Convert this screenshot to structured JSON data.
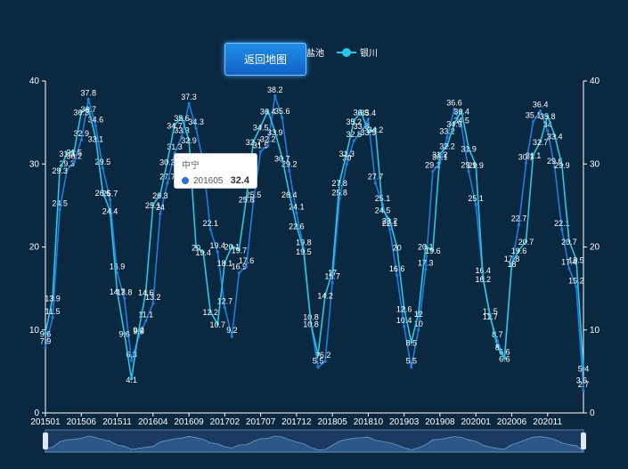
{
  "back_button": "返回地图",
  "legend": [
    {
      "name": "盐池",
      "color": "#1e7ee0"
    },
    {
      "name": "银川",
      "color": "#29c6e8"
    }
  ],
  "tooltip": {
    "title": "中宁",
    "category": "201605",
    "value": "32.4",
    "color": "#2f6fd8"
  },
  "chart_data": {
    "type": "line",
    "ylim": [
      0,
      40
    ],
    "y_ticks": [
      "0",
      "10",
      "20",
      "30",
      "40"
    ],
    "x_tick_labels": [
      "201501",
      "201506",
      "201511",
      "201604",
      "201609",
      "201702",
      "201707",
      "201712",
      "201805",
      "201810",
      "201903",
      "201908",
      "202001",
      "202006",
      "202011"
    ],
    "x_start": "201501",
    "x_end": "202011",
    "series": [
      {
        "name": "盐池",
        "color": "#1e7ee0",
        "values": [
          7.9,
          11.5,
          24.5,
          29.3,
          30.2,
          32.9,
          37.8,
          34.6,
          29.5,
          25.7,
          16.9,
          13.8,
          6.3,
          9.2,
          11.1,
          13.2,
          24,
          27.7,
          31.3,
          33.3,
          37.3,
          34.3,
          30.2,
          22.1,
          19.4,
          12.7,
          9.2,
          16.9,
          17.6,
          25.5,
          31.5,
          32.2,
          38.2,
          35.6,
          29.2,
          24.1,
          19.8,
          10.8,
          5.5,
          6.2,
          15.7,
          25.8,
          30,
          32.8,
          33.8,
          35.4,
          27.7,
          25.1,
          22.1,
          16.6,
          10.4,
          5.5,
          10,
          17.3,
          29.1,
          30.1,
          33.2,
          36.6,
          34.5,
          29.1,
          25.1,
          16.4,
          11.5,
          8.7,
          6.6,
          17.8,
          22.7,
          30.1,
          35.1,
          36.4,
          34,
          29.6,
          22.1,
          17.4,
          15.2,
          2.7
        ]
      },
      {
        "name": "银川",
        "color": "#29c6e8",
        "values": [
          9.6,
          13.9,
          29.3,
          31.3,
          31.5,
          36.3,
          36.7,
          33.1,
          26.6,
          24.4,
          14.7,
          9.6,
          4.1,
          9.9,
          14.6,
          25.1,
          26.3,
          30.3,
          34.7,
          35.6,
          32.9,
          20,
          19.4,
          12.2,
          10.7,
          18.1,
          20.1,
          19.7,
          25.8,
          32.7,
          34.5,
          36.4,
          33.9,
          30.7,
          26.4,
          22.6,
          19.5,
          10.8,
          7,
          14.2,
          17,
          27.8,
          31.3,
          35.2,
          36.3,
          33.9,
          34.2,
          24.5,
          23.2,
          20,
          12.6,
          8.5,
          12,
          20.1,
          19.6,
          31.2,
          32.2,
          34.9,
          36.4,
          31.9,
          29.9,
          16.2,
          11.7,
          8,
          6.6,
          18,
          19.6,
          20.7,
          31.1,
          32.7,
          35.8,
          33.4,
          29.9,
          20.7,
          18.5,
          5.4
        ]
      }
    ],
    "point_labels_left_axis": [
      "3.6"
    ]
  }
}
